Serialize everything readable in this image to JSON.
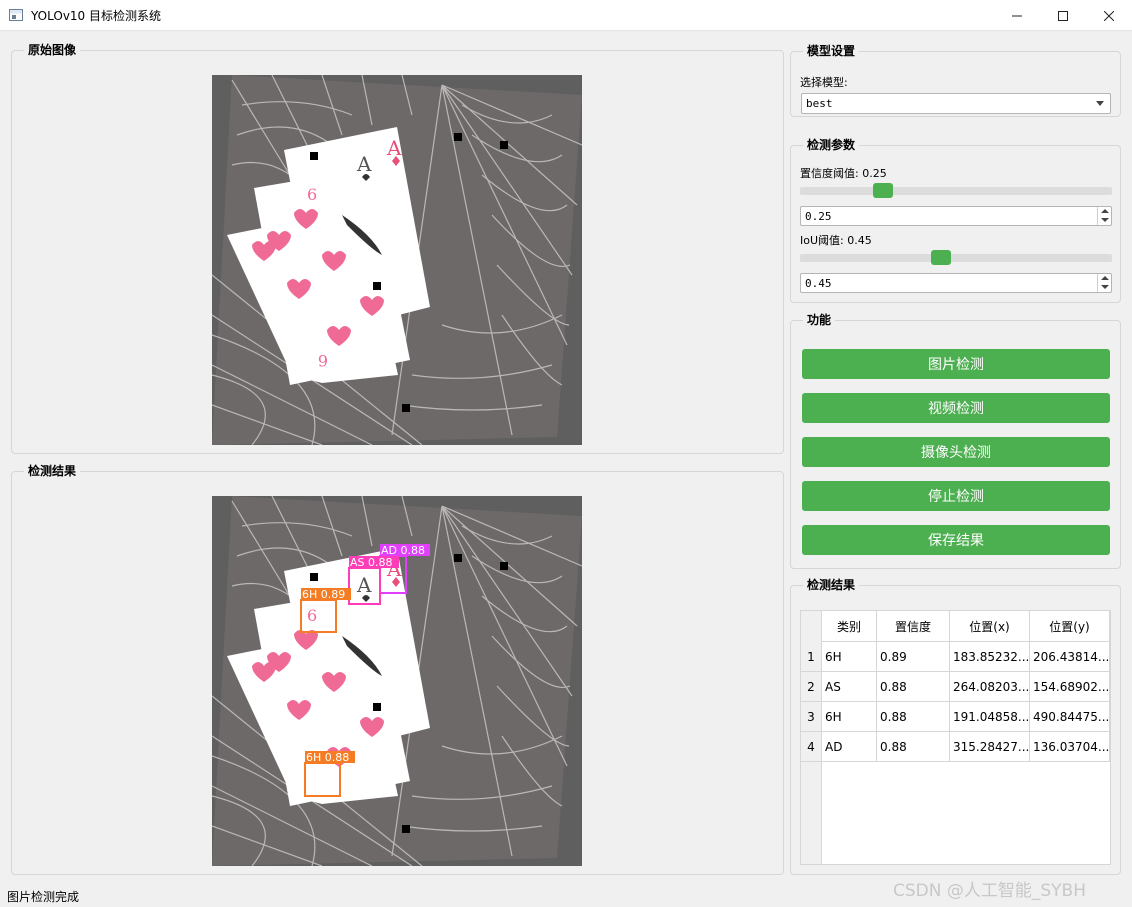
{
  "window": {
    "title": "YOLOv10 目标检测系统",
    "minimize_icon": "minimize-icon",
    "maximize_icon": "maximize-icon",
    "close_icon": "close-icon"
  },
  "original_panel": {
    "title": "原始图像"
  },
  "result_panel": {
    "title": "检测结果",
    "detection_labels": [
      {
        "text": "AD 0.88",
        "color": "#e040fb"
      },
      {
        "text": "AS 0.88",
        "color": "#ff3db8"
      },
      {
        "text": "6H 0.89",
        "color": "#f57c22"
      },
      {
        "text": "6H 0.88",
        "color": "#f57c22"
      }
    ]
  },
  "model_settings": {
    "title": "模型设置",
    "select_label": "选择模型:",
    "selected_model": "best"
  },
  "detection_params": {
    "title": "检测参数",
    "confidence_label": "置信度阈值: 0.25",
    "confidence_value": "0.25",
    "confidence_level": 0.25,
    "iou_label": "IoU阈值: 0.45",
    "iou_value": "0.45",
    "iou_level": 0.45
  },
  "functions": {
    "title": "功能",
    "buttons": [
      "图片检测",
      "视频检测",
      "摄像头检测",
      "停止检测",
      "保存结果"
    ],
    "button_color": "#4caf50"
  },
  "results_table": {
    "title": "检测结果",
    "headers": [
      "类别",
      "置信度",
      "位置(x)",
      "位置(y)"
    ],
    "rows": [
      {
        "num": "1",
        "cls": "6H",
        "conf": "0.89",
        "x": "183.85232...",
        "y": "206.43814..."
      },
      {
        "num": "2",
        "cls": "AS",
        "conf": "0.88",
        "x": "264.08203...",
        "y": "154.68902..."
      },
      {
        "num": "3",
        "cls": "6H",
        "conf": "0.88",
        "x": "191.04858...",
        "y": "490.84475..."
      },
      {
        "num": "4",
        "cls": "AD",
        "conf": "0.88",
        "x": "315.28427...",
        "y": "136.03704..."
      }
    ]
  },
  "status": {
    "text": "图片检测完成"
  },
  "watermark": {
    "text": "CSDN @人工智能_SYBH"
  }
}
